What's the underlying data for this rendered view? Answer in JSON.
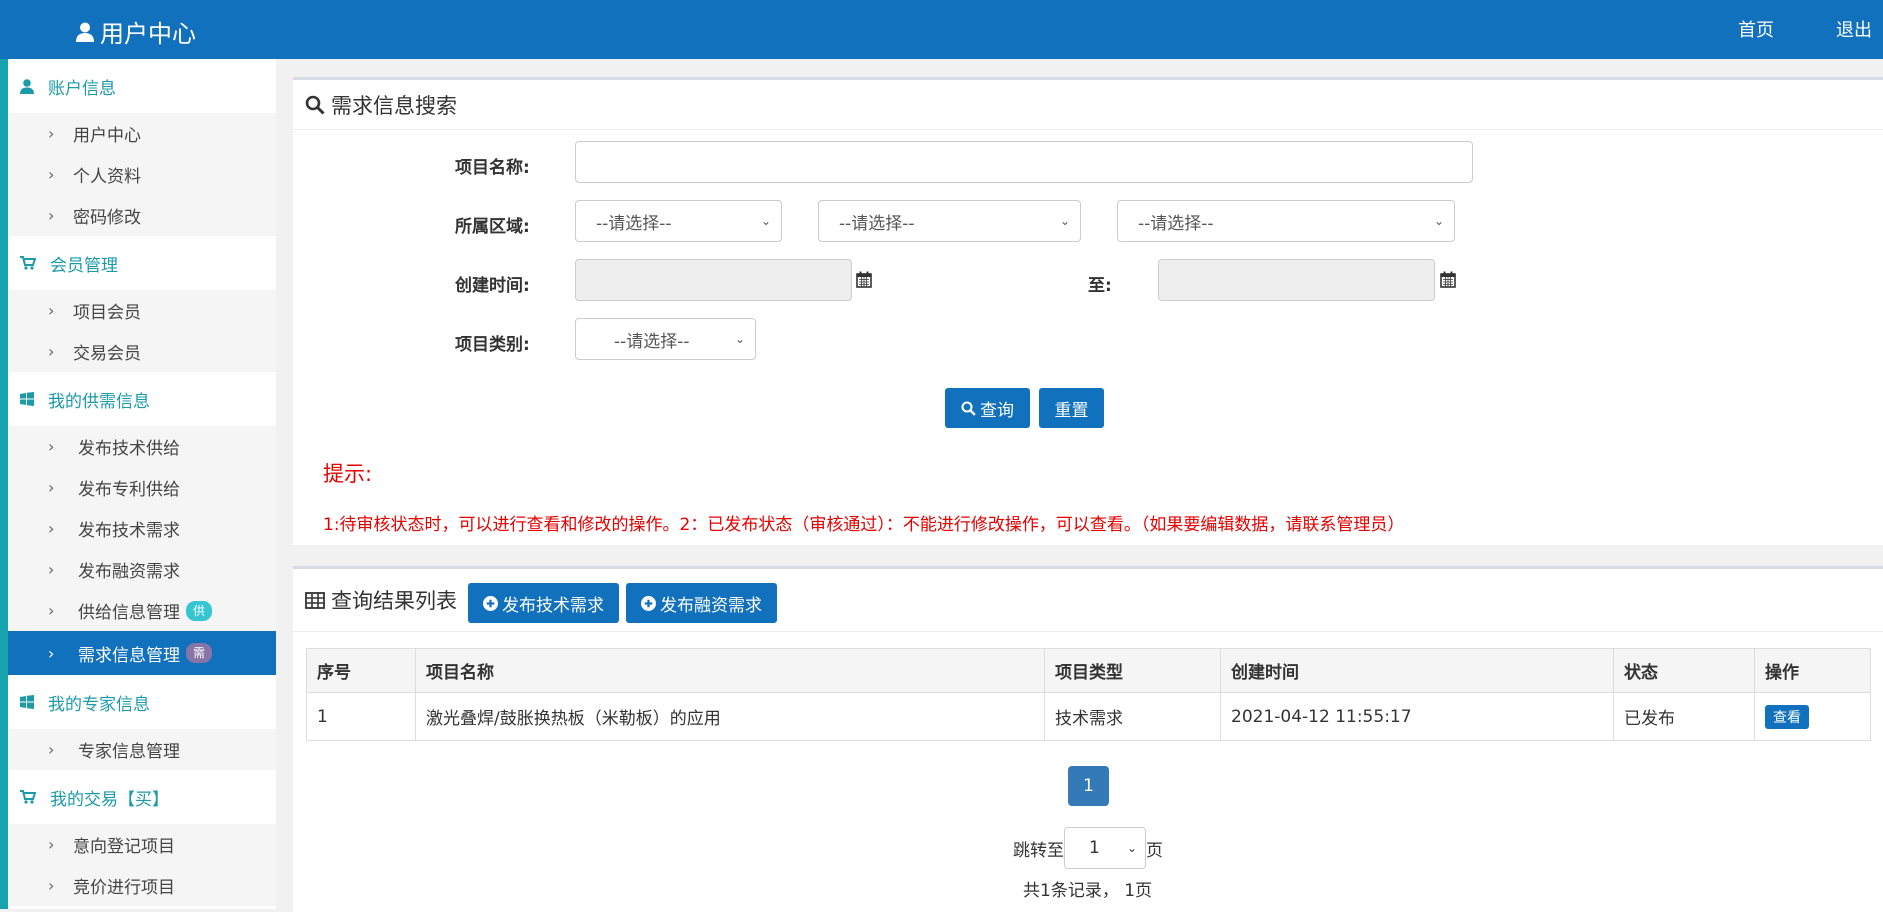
{
  "header": {
    "title": "用户中心",
    "links": {
      "home": "首页",
      "logout": "退出"
    }
  },
  "sidebar": {
    "groups": [
      {
        "label": "账户信息",
        "icon": "user-icon",
        "items": [
          "用户中心",
          "个人资料",
          "密码修改"
        ]
      },
      {
        "label": "会员管理",
        "icon": "cart-icon",
        "items": [
          "项目会员",
          "交易会员"
        ]
      },
      {
        "label": "我的供需信息",
        "icon": "windows-icon",
        "items": [
          "发布技术供给",
          "发布专利供给",
          "发布技术需求",
          "发布融资需求",
          "供给信息管理",
          "需求信息管理"
        ]
      },
      {
        "label": "我的专家信息",
        "icon": "windows-icon",
        "items": [
          "专家信息管理"
        ]
      },
      {
        "label": "我的交易【买】",
        "icon": "cart-icon",
        "items": [
          "意向登记项目",
          "竞价进行项目"
        ]
      }
    ],
    "badges": {
      "supply": "供",
      "demand": "需"
    },
    "active_item": "需求信息管理"
  },
  "search": {
    "title": "需求信息搜索",
    "labels": {
      "name": "项目名称:",
      "region": "所属区域:",
      "created": "创建时间:",
      "to": "至:",
      "category": "项目类别:"
    },
    "select_placeholder": "--请选择--",
    "buttons": {
      "query": "查询",
      "reset": "重置"
    },
    "tip_title": "提示:",
    "tip_text": "1:待审核状态时，可以进行查看和修改的操作。2：已发布状态（审核通过）：不能进行修改操作，可以查看。（如果要编辑数据，请联系管理员）"
  },
  "results": {
    "title": "查询结果列表",
    "buttons": {
      "publish_tech": "发布技术需求",
      "publish_finance": "发布融资需求"
    },
    "columns": [
      "序号",
      "项目名称",
      "项目类型",
      "创建时间",
      "状态",
      "操作"
    ],
    "rows": [
      {
        "index": "1",
        "name": "激光叠焊/鼓胀换热板（米勒板）的应用",
        "type": "技术需求",
        "created": "2021-04-12 11:55:17",
        "status": "已发布",
        "action": "查看"
      }
    ],
    "pagination": {
      "current": "1",
      "jump_label": "跳转至",
      "jump_value": "1",
      "page_suffix": "页",
      "total": "共1条记录，  1页"
    }
  },
  "colors": {
    "primary": "#1271bd",
    "teal": "#1b9ba8",
    "tip_red": "#e60000",
    "badge_supply": "#36c6d3",
    "badge_demand": "#8775a7"
  }
}
